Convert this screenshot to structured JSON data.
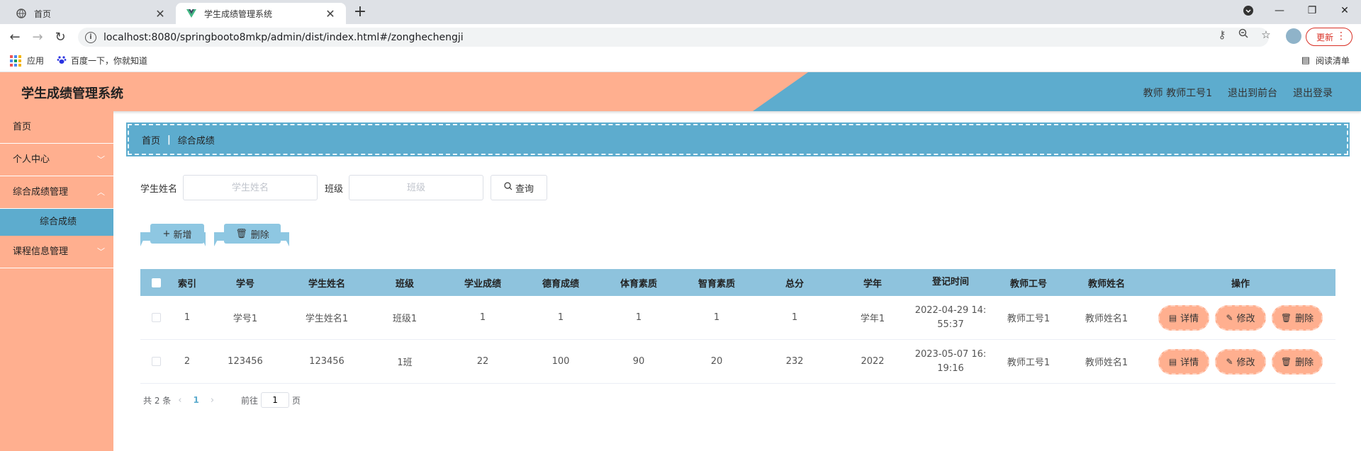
{
  "browser": {
    "tabs": [
      {
        "title": "首页"
      },
      {
        "title": "学生成绩管理系统"
      }
    ],
    "url": "localhost:8080/springbooto8mkp/admin/dist/index.html#/zonghechengji",
    "update_label": "更新",
    "bookmarks": {
      "apps": "应用",
      "baidu": "百度一下，你就知道"
    },
    "reading_list": "阅读清单"
  },
  "header": {
    "title": "学生成绩管理系统",
    "user": "教师 教师工号1",
    "back_to_front": "退出到前台",
    "logout": "退出登录"
  },
  "sidebar": {
    "items": [
      {
        "label": "首页"
      },
      {
        "label": "个人中心"
      },
      {
        "label": "综合成绩管理"
      },
      {
        "label": "综合成绩"
      },
      {
        "label": "课程信息管理"
      }
    ]
  },
  "breadcrumb": {
    "home": "首页",
    "current": "综合成绩"
  },
  "search": {
    "name_label": "学生姓名",
    "name_placeholder": "学生姓名",
    "class_label": "班级",
    "class_placeholder": "班级",
    "query_label": "查询"
  },
  "actions": {
    "add": "新增",
    "delete": "删除"
  },
  "table": {
    "headers": [
      "索引",
      "学号",
      "学生姓名",
      "班级",
      "学业成绩",
      "德育成绩",
      "体育素质",
      "智育素质",
      "总分",
      "学年",
      "登记时间",
      "教师工号",
      "教师姓名",
      "操作"
    ],
    "rows": [
      {
        "index": "1",
        "no": "学号1",
        "name": "学生姓名1",
        "class": "班级1",
        "academic": "1",
        "moral": "1",
        "sports": "1",
        "intellect": "1",
        "total": "1",
        "year": "学年1",
        "time_a": "2022-04-29 14:",
        "time_b": "55:37",
        "teacher_id": "教师工号1",
        "teacher_name": "教师姓名1"
      },
      {
        "index": "2",
        "no": "123456",
        "name": "123456",
        "class": "1班",
        "academic": "22",
        "moral": "100",
        "sports": "90",
        "intellect": "20",
        "total": "232",
        "year": "2022",
        "time_a": "2023-05-07 16:",
        "time_b": "19:16",
        "teacher_id": "教师工号1",
        "teacher_name": "教师姓名1"
      }
    ],
    "ops": {
      "detail": "详情",
      "edit": "修改",
      "delete": "删除"
    }
  },
  "pager": {
    "total": "共 2 条",
    "current": "1",
    "goto": "前往",
    "page_value": "1",
    "page_suffix": "页"
  },
  "colors": {
    "peach": "#ffaf8f",
    "blue": "#5dacce",
    "light_blue": "#8ec3dd"
  }
}
